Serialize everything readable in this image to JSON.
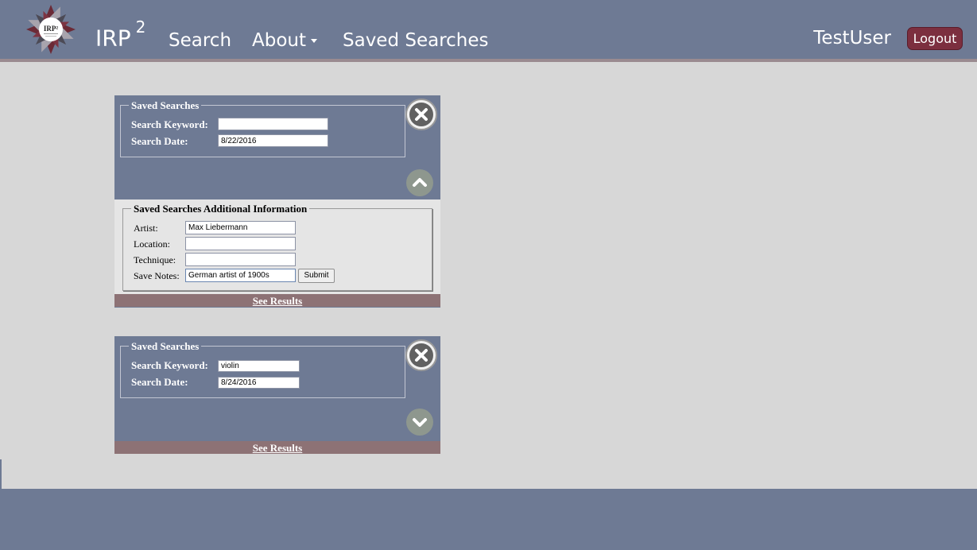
{
  "header": {
    "brand": "IRP",
    "brand_sup": "2",
    "logo_text": "IRP²",
    "nav": {
      "search": "Search",
      "about": "About",
      "saved_searches": "Saved Searches"
    },
    "username": "TestUser",
    "logout": "Logout"
  },
  "panels": [
    {
      "legend": "Saved Searches",
      "keyword_label": "Search Keyword:",
      "keyword_value": "",
      "date_label": "Search Date:",
      "date_value": "8/22/2016",
      "toggle_icon": "chevron-up-icon",
      "expanded": true,
      "additional": {
        "legend": "Saved Searches Additional Information",
        "artist_label": "Artist:",
        "artist_value": "Max Liebermann",
        "location_label": "Location:",
        "location_value": "",
        "technique_label": "Technique:",
        "technique_value": "",
        "notes_label": "Save Notes:",
        "notes_value": "German artist of 1900s",
        "submit": "Submit"
      },
      "see_results": "See Results"
    },
    {
      "legend": "Saved Searches",
      "keyword_label": "Search Keyword:",
      "keyword_value": "violin",
      "date_label": "Search Date:",
      "date_value": "8/24/2016",
      "toggle_icon": "chevron-down-icon",
      "expanded": false,
      "see_results": "See Results"
    }
  ],
  "colors": {
    "navbar": "#6e7a94",
    "logout_button": "#7c2f3f",
    "see_results_bar": "#8d7275",
    "page_background": "#d7d7d7"
  }
}
